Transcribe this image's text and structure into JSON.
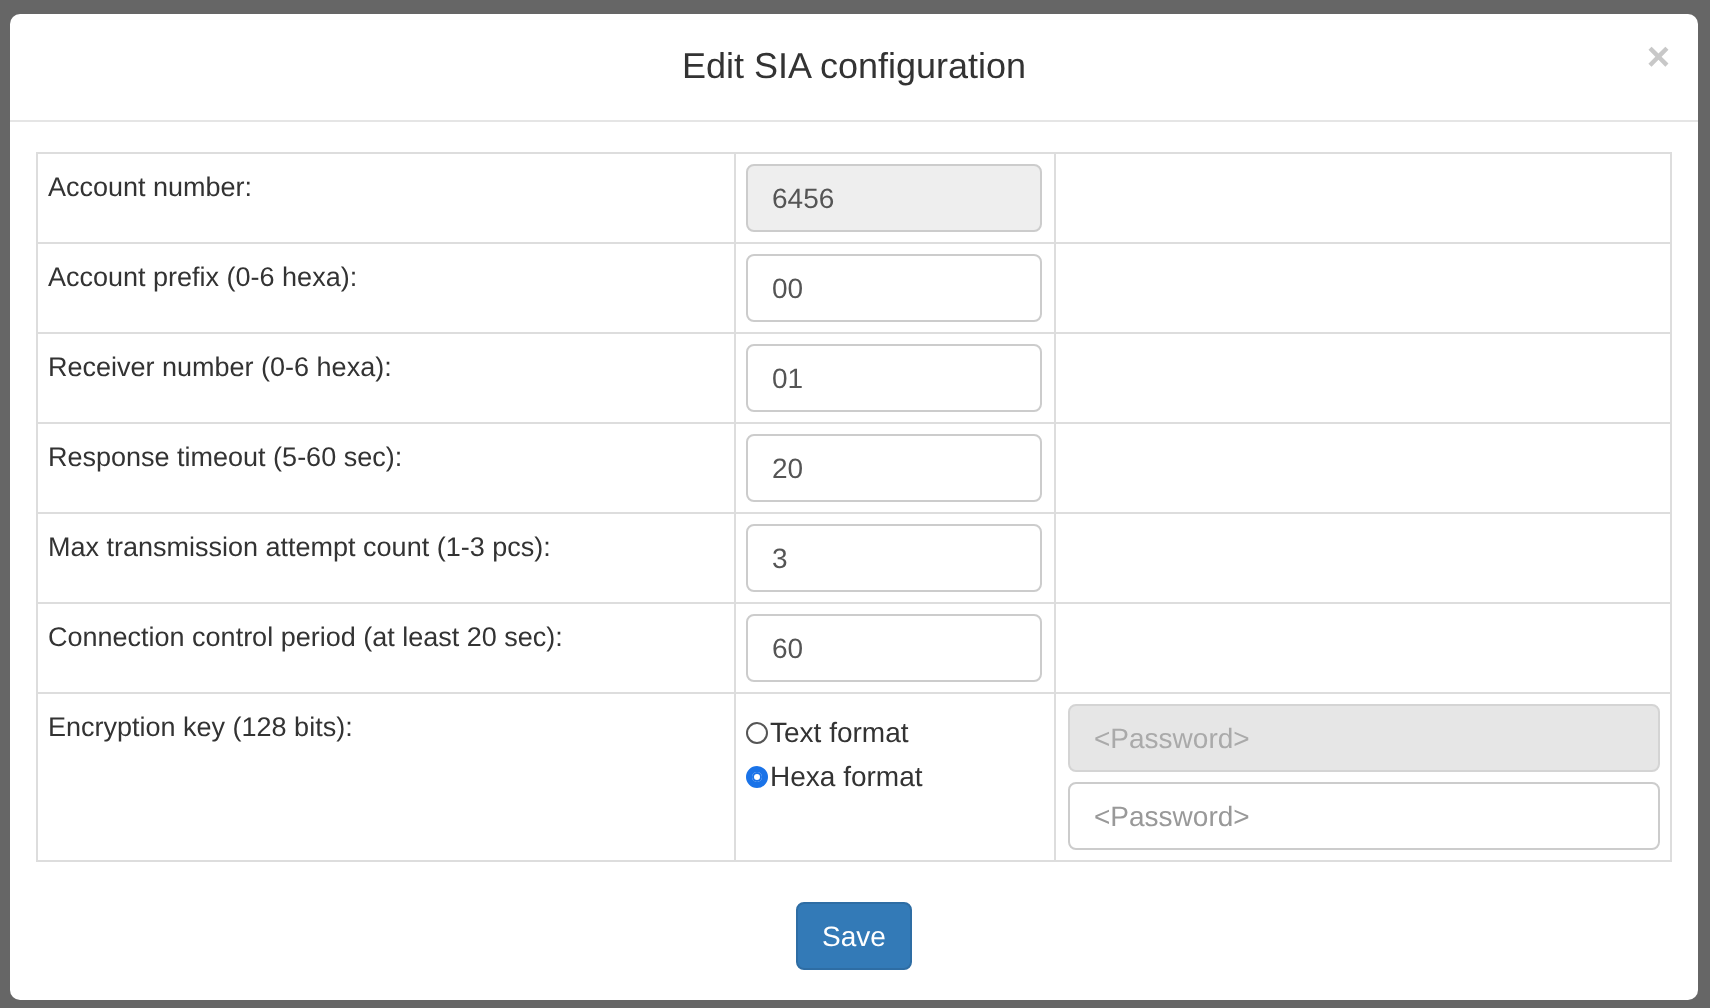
{
  "modal": {
    "title": "Edit SIA configuration",
    "close": "×"
  },
  "rows": [
    {
      "kind": "input",
      "label": "Account number:",
      "value": "6456",
      "disabled": true
    },
    {
      "kind": "input",
      "label": "Account prefix (0-6 hexa):",
      "value": "00",
      "disabled": false
    },
    {
      "kind": "input",
      "label": "Receiver number (0-6 hexa):",
      "value": "01",
      "disabled": false
    },
    {
      "kind": "input",
      "label": "Response timeout (5-60 sec):",
      "value": "20",
      "disabled": false
    },
    {
      "kind": "input",
      "label": "Max transmission attempt count (1-3 pcs):",
      "value": "3",
      "disabled": false
    },
    {
      "kind": "input",
      "label": "Connection control period (at least 20 sec):",
      "value": "60",
      "disabled": false
    },
    {
      "kind": "encryption",
      "label": "Encryption key (128 bits):",
      "radios": [
        {
          "label": "Text format",
          "selected": false
        },
        {
          "label": "Hexa format",
          "selected": true
        }
      ],
      "fields": [
        {
          "placeholder": "<Password>",
          "disabled": true
        },
        {
          "placeholder": "<Password>",
          "disabled": false
        }
      ]
    }
  ],
  "save_button": "Save"
}
